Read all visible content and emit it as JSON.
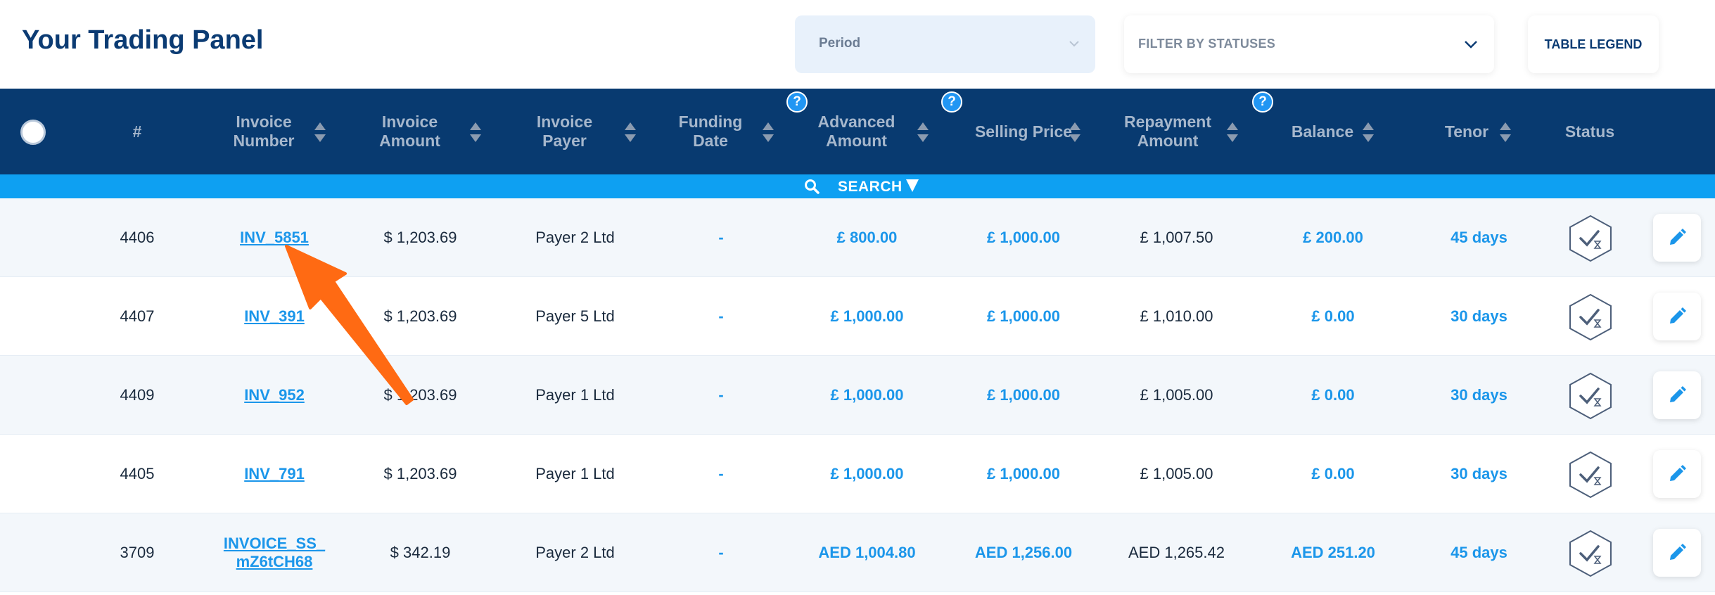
{
  "header": {
    "title": "Your Trading Panel",
    "period_placeholder": "Period",
    "filter_label": "FILTER BY STATUSES",
    "legend_label": "TABLE LEGEND"
  },
  "columns": [
    {
      "key": "num",
      "label": "#"
    },
    {
      "key": "invoice_number",
      "label": "Invoice Number"
    },
    {
      "key": "invoice_amount",
      "label": "Invoice Amount"
    },
    {
      "key": "invoice_payer",
      "label": "Invoice Payer"
    },
    {
      "key": "funding_date",
      "label": "Funding Date"
    },
    {
      "key": "advanced_amount",
      "label": "Advanced Amount"
    },
    {
      "key": "selling_price",
      "label": "Selling Price"
    },
    {
      "key": "repayment_amount",
      "label": "Repayment Amount"
    },
    {
      "key": "balance",
      "label": "Balance"
    },
    {
      "key": "tenor",
      "label": "Tenor"
    },
    {
      "key": "status",
      "label": "Status"
    }
  ],
  "help_icon_text": "?",
  "search_label": "SEARCH",
  "rows": [
    {
      "num": "4406",
      "invoice": "INV_5851",
      "amount": "$ 1,203.69",
      "payer": "Payer 2 Ltd",
      "funding": "-",
      "advanced": "£ 800.00",
      "selling": "£ 1,000.00",
      "repayment": "£ 1,007.50",
      "balance": "£ 200.00",
      "tenor": "45 days"
    },
    {
      "num": "4407",
      "invoice": "INV_391",
      "amount": "$ 1,203.69",
      "payer": "Payer 5 Ltd",
      "funding": "-",
      "advanced": "£ 1,000.00",
      "selling": "£ 1,000.00",
      "repayment": "£ 1,010.00",
      "balance": "£ 0.00",
      "tenor": "30 days"
    },
    {
      "num": "4409",
      "invoice": "INV_952",
      "amount": "$ 1,203.69",
      "payer": "Payer 1 Ltd",
      "funding": "-",
      "advanced": "£ 1,000.00",
      "selling": "£ 1,000.00",
      "repayment": "£ 1,005.00",
      "balance": "£ 0.00",
      "tenor": "30 days"
    },
    {
      "num": "4405",
      "invoice": "INV_791",
      "amount": "$ 1,203.69",
      "payer": "Payer 1 Ltd",
      "funding": "-",
      "advanced": "£ 1,000.00",
      "selling": "£ 1,000.00",
      "repayment": "£ 1,005.00",
      "balance": "£ 0.00",
      "tenor": "30 days"
    },
    {
      "num": "3709",
      "invoice": "INVOICE_SS_ mZ6tCH68",
      "amount": "$ 342.19",
      "payer": "Payer 2 Ltd",
      "funding": "-",
      "advanced": "AED 1,004.80",
      "selling": "AED 1,256.00",
      "repayment": "AED 1,265.42",
      "balance": "AED 251.20",
      "tenor": "45 days"
    }
  ],
  "icons": {
    "status": "hexagon-check-hourglass-icon",
    "edit": "pencil-icon",
    "sort": "sort-arrows-icon",
    "help": "question-icon",
    "search": "search-icon"
  },
  "colors": {
    "header_bg": "#083a70",
    "search_bar": "#0ea0f2",
    "accent_blue": "#1b96ea",
    "annotation_arrow": "#ff6a13"
  }
}
